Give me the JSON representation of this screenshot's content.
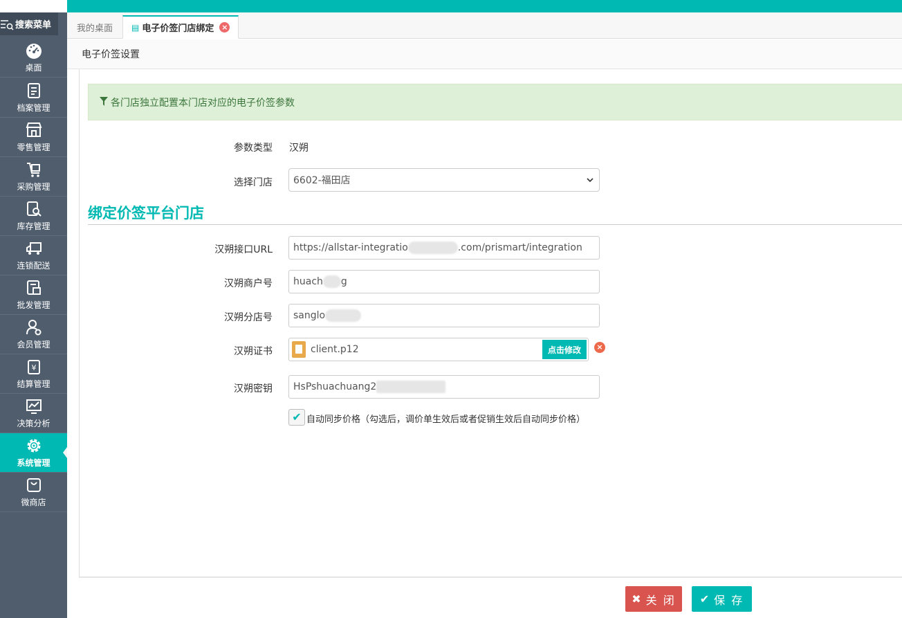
{
  "sidebar": {
    "search_label": "搜索菜单",
    "items": [
      {
        "label": "桌面",
        "icon": "dashboard-icon"
      },
      {
        "label": "档案管理",
        "icon": "archive-icon"
      },
      {
        "label": "零售管理",
        "icon": "store-icon"
      },
      {
        "label": "采购管理",
        "icon": "cart-icon"
      },
      {
        "label": "库存管理",
        "icon": "inventory-search-icon"
      },
      {
        "label": "连锁配送",
        "icon": "truck-icon"
      },
      {
        "label": "批发管理",
        "icon": "wholesale-icon"
      },
      {
        "label": "会员管理",
        "icon": "member-icon"
      },
      {
        "label": "结算管理",
        "icon": "settlement-icon"
      },
      {
        "label": "决策分析",
        "icon": "chart-icon"
      },
      {
        "label": "系统管理",
        "icon": "gear-icon"
      },
      {
        "label": "微商店",
        "icon": "shop-bag-icon"
      }
    ]
  },
  "tabs": [
    {
      "label": "我的桌面"
    },
    {
      "label": "电子价签门店绑定"
    }
  ],
  "page_header": "电子价签设置",
  "alert": "各门店独立配置本门店对应的电子价签参数",
  "form": {
    "param_type_label": "参数类型",
    "param_type_value": "汉朔",
    "store_label": "选择门店",
    "store_value": "6602-福田店",
    "section_title": "绑定价签平台门店",
    "url_label": "汉朔接口URL",
    "url_prefix": "https://allstar-integratio",
    "url_suffix": ".com/prismart/integration",
    "merchant_label": "汉朔商户号",
    "merchant_prefix": "huach",
    "merchant_suffix": "g",
    "branch_label": "汉朔分店号",
    "branch_prefix": "sanglo",
    "cert_label": "汉朔证书",
    "cert_file": "client.p12",
    "cert_button": "点击修改",
    "secret_label": "汉朔密钥",
    "secret_prefix": "HsPshuachuang2",
    "auto_sync_label": "自动同步价格（勾选后，调价单生效后或者促销生效后自动同步价格）",
    "auto_sync_checked": true
  },
  "footer": {
    "close_label": "关 闭",
    "save_label": "保 存"
  },
  "colors": {
    "accent": "#00b9b2",
    "sidebar": "#4f5d6d",
    "danger": "#d9534f",
    "alert_bg": "#dff0d8"
  }
}
